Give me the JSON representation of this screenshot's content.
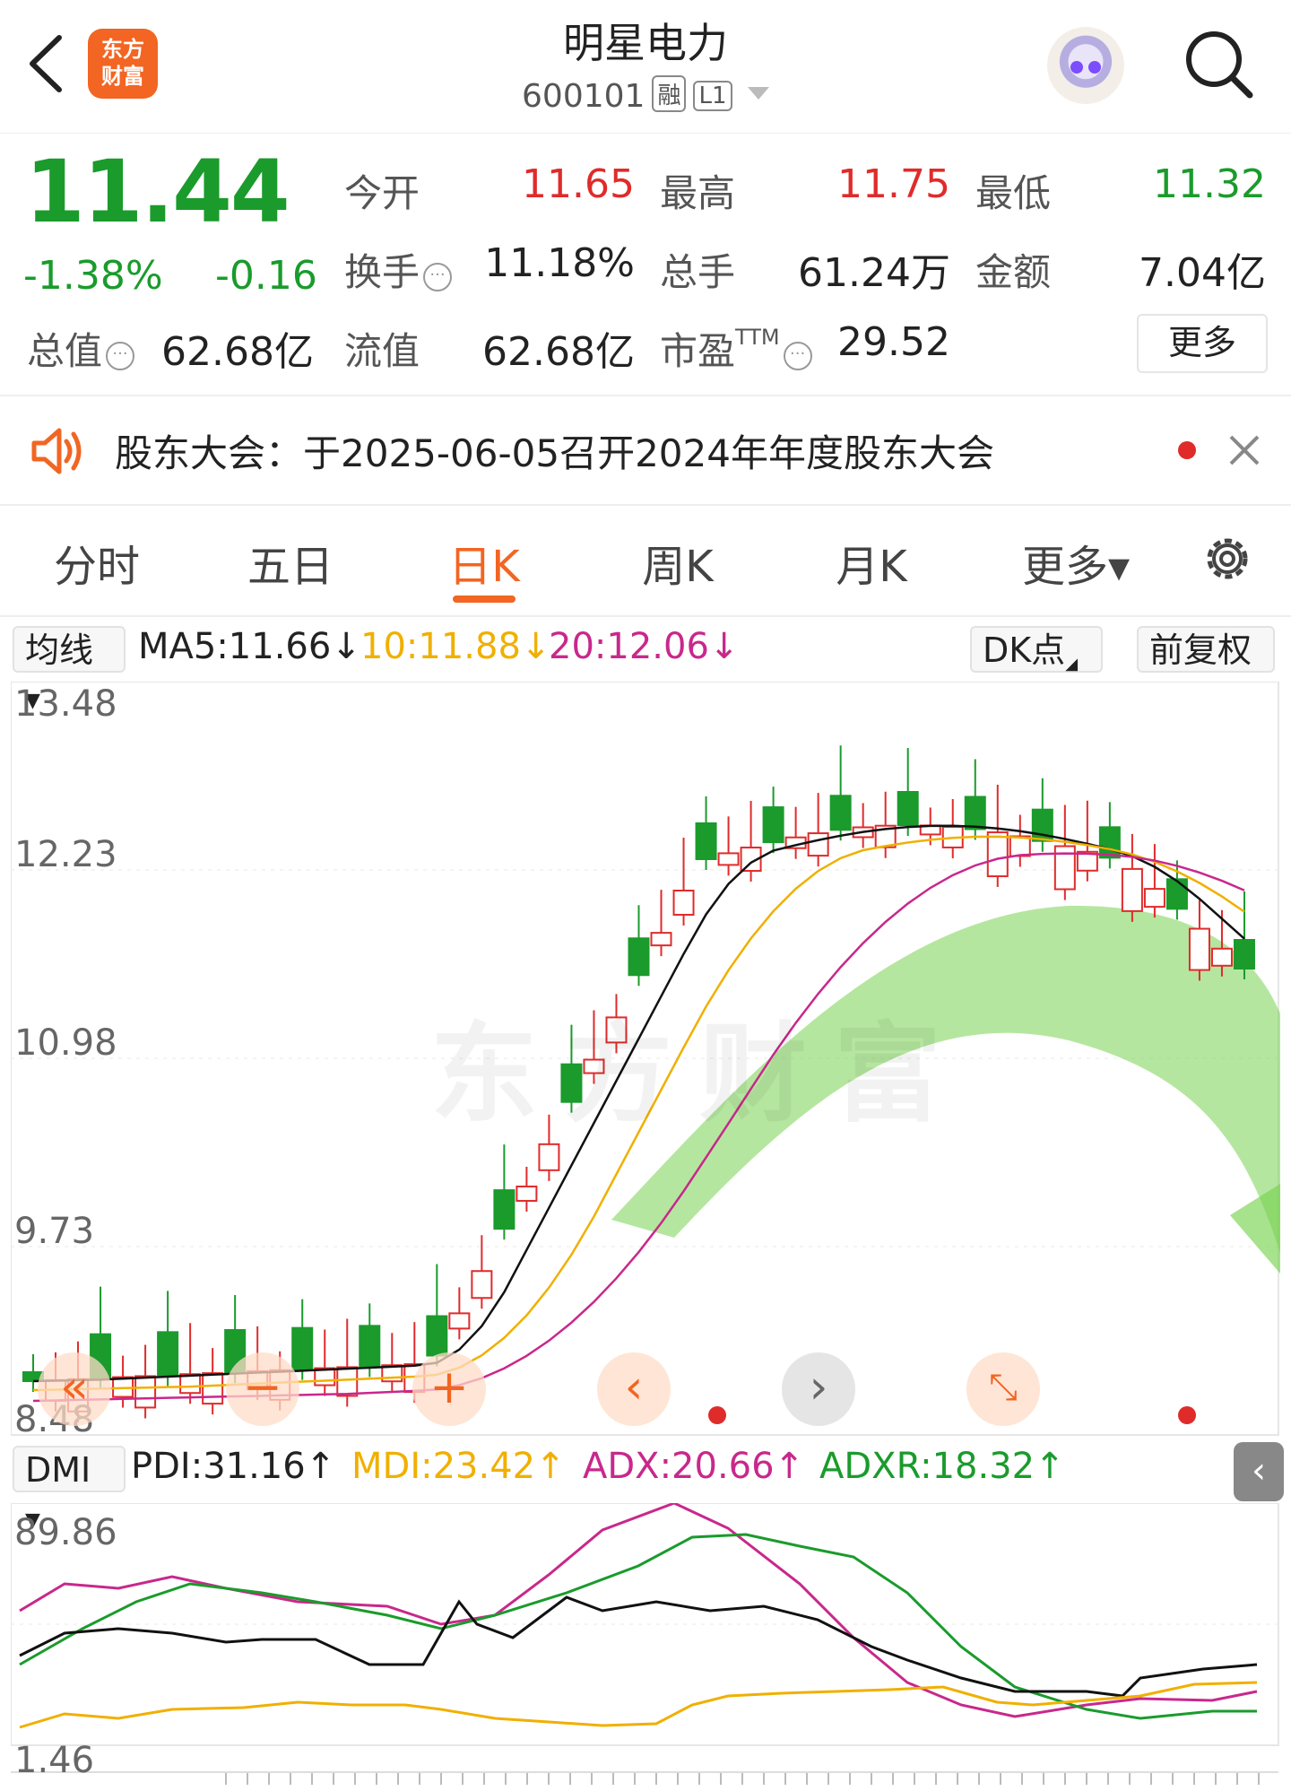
{
  "header": {
    "title": "明星电力",
    "code": "600101",
    "tag1": "融",
    "tag2": "L1",
    "logo_line1": "东方",
    "logo_line2": "财富"
  },
  "quote": {
    "price": "11.44",
    "change_pct": "-1.38%",
    "change": "-0.16",
    "rows": [
      [
        {
          "label": "今开",
          "value": "11.65",
          "color": "red"
        },
        {
          "label": "最高",
          "value": "11.75",
          "color": "red"
        },
        {
          "label": "最低",
          "value": "11.32",
          "color": "green"
        }
      ],
      [
        {
          "label": "换手",
          "value": "11.18%",
          "color": "dark"
        },
        {
          "label": "总手",
          "value": "61.24万",
          "color": "dark"
        },
        {
          "label": "金额",
          "value": "7.04亿",
          "color": "dark"
        }
      ],
      [
        {
          "label": "总值",
          "value": "62.68亿",
          "color": "dark"
        },
        {
          "label": "流值",
          "value": "62.68亿",
          "color": "dark"
        },
        {
          "label": "市盈",
          "value": "29.52",
          "color": "dark"
        }
      ]
    ],
    "ttm_label": "TTM",
    "more_button": "更多"
  },
  "notice": {
    "text": "股东大会：于2025-06-05召开2024年年度股东大会"
  },
  "tabs": [
    {
      "label": "分时",
      "active": false
    },
    {
      "label": "五日",
      "active": false
    },
    {
      "label": "日K",
      "active": true
    },
    {
      "label": "周K",
      "active": false
    },
    {
      "label": "月K",
      "active": false
    },
    {
      "label": "更多▾",
      "active": false
    }
  ],
  "kline": {
    "selector": "均线",
    "ma5": "MA5:11.66↓",
    "ma10": "10:11.88↓",
    "ma20": "20:12.06↓",
    "dk_button": "DK点",
    "adjust_button": "前复权",
    "y_labels": [
      "13.48",
      "12.23",
      "10.98",
      "9.73",
      "8.48"
    ]
  },
  "dmi": {
    "selector": "DMI",
    "pdi": "PDI:31.16↑",
    "mdi": "MDI:23.42↑",
    "adx": "ADX:20.66↑",
    "adxr": "ADXR:18.32↑",
    "y_labels": [
      "89.86",
      "1.46"
    ]
  },
  "watermark": "东方财富",
  "colors": {
    "up": "#e02b2b",
    "down": "#1a9b2c",
    "accent": "#f26522",
    "ma5": "#111111",
    "ma10": "#f0b000",
    "ma20": "#c8288c"
  }
}
